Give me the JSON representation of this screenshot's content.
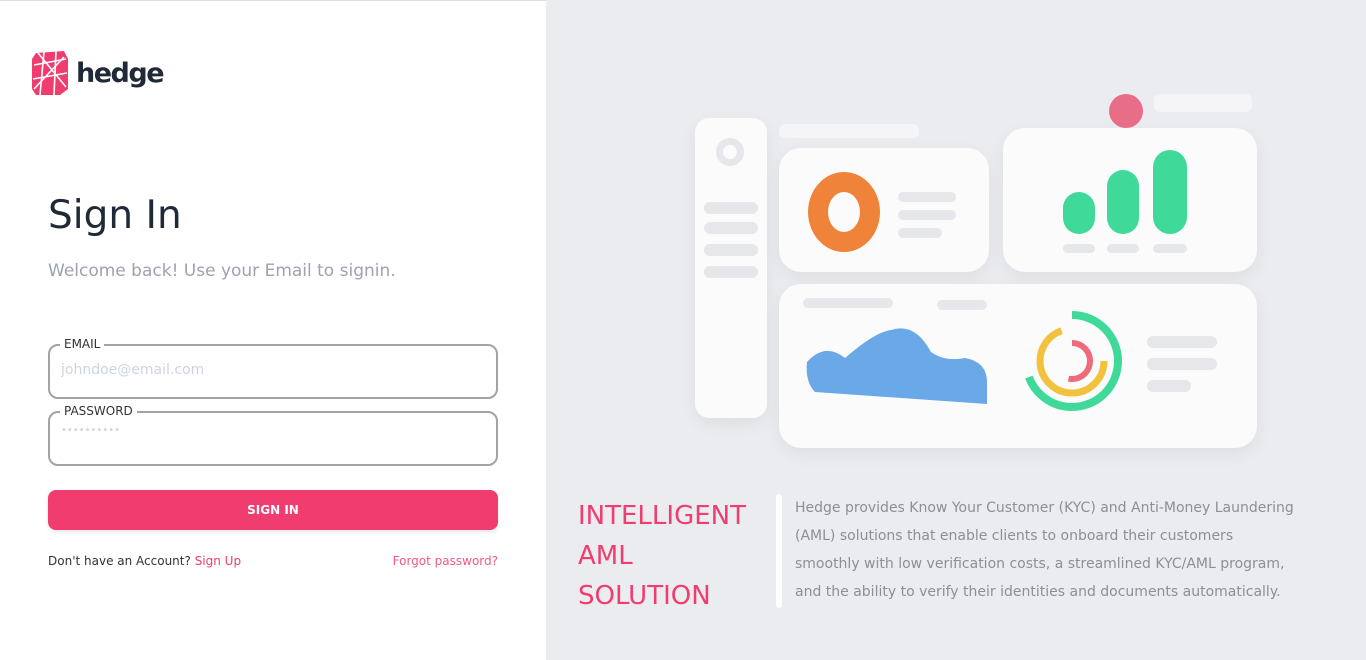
{
  "brand": {
    "name": "hedge",
    "color": "#f03c6e"
  },
  "signin": {
    "title": "Sign In",
    "subtitle": "Welcome back! Use your Email to signin.",
    "email": {
      "label": "EMAIL",
      "placeholder": "johndoe@email.com"
    },
    "password": {
      "label": "PASSWORD",
      "placeholder": "••••••••••"
    },
    "button": "SIGN IN",
    "no_account": "Don't have an Account?",
    "signup": "Sign Up",
    "forgot": "Forgot password?"
  },
  "promo": {
    "tagline": [
      "INTELLIGENT",
      "AML",
      "SOLUTION"
    ],
    "description": "Hedge provides Know Your Customer (KYC) and Anti-Money Laundering (AML) solutions that enable clients to onboard their customers smoothly with low verification costs, a streamlined KYC/AML program, and the ability to verify their identities and documents automatically."
  }
}
